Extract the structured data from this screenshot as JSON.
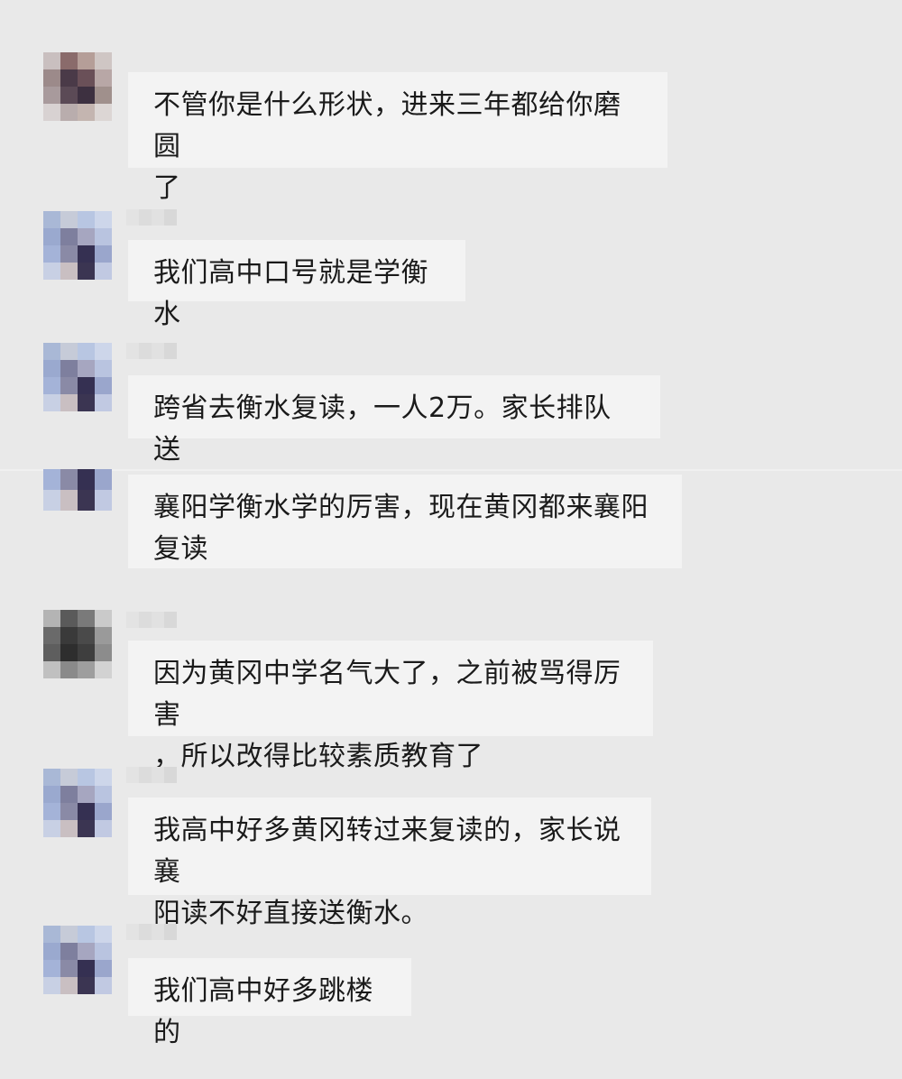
{
  "messages": [
    {
      "text": "不管你是什么形状，进来三年都给你磨圆\n了",
      "avatar": "avatar-brown"
    },
    {
      "text": "我们高中口号就是学衡水",
      "avatar": "avatar-blue"
    },
    {
      "text": "跨省去衡水复读，一人2万。家长排队送",
      "avatar": "avatar-blue"
    },
    {
      "text": "襄阳学衡水学的厉害，现在黄冈都来襄阳\n复读",
      "avatar": "avatar-blue"
    },
    {
      "text": "因为黄冈中学名气大了，之前被骂得厉害\n，所以改得比较素质教育了",
      "avatar": "avatar-dark"
    },
    {
      "text": "我高中好多黄冈转过来复读的，家长说襄\n阳读不好直接送衡水。",
      "avatar": "avatar-blue"
    },
    {
      "text": "我们高中好多跳楼的",
      "avatar": "avatar-blue"
    }
  ],
  "colors": {
    "background": "#e9e9e9",
    "bubble": "#f3f3f3",
    "text": "#1a1a1a"
  }
}
